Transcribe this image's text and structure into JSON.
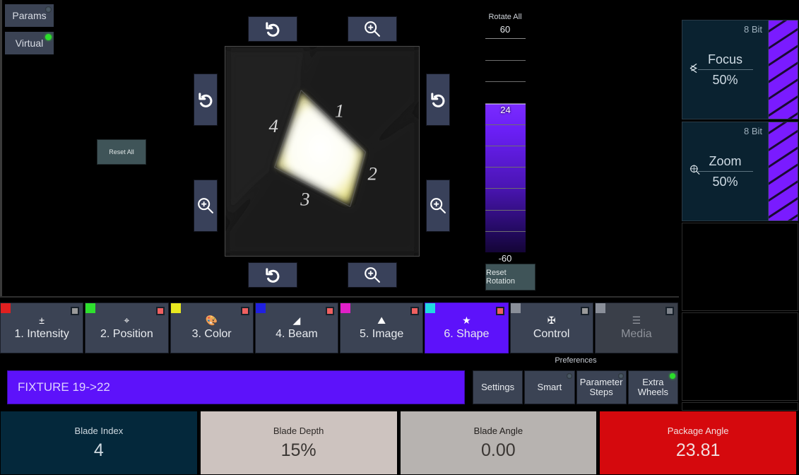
{
  "mode_buttons": [
    {
      "label": "Params",
      "led": "off",
      "name": "params-button"
    },
    {
      "label": "Virtual",
      "led": "on",
      "name": "virtual-button"
    }
  ],
  "preview": {
    "reset_all_label": "Reset All",
    "blade_labels": [
      "1",
      "2",
      "3",
      "4"
    ],
    "nudge_buttons": [
      {
        "name": "rotate-top-button",
        "icon": "rotate-ccw-icon"
      },
      {
        "name": "zoom-top-button",
        "icon": "zoom-in-icon"
      },
      {
        "name": "rotate-left-button",
        "icon": "rotate-ccw-icon"
      },
      {
        "name": "zoom-left-button",
        "icon": "zoom-in-icon"
      },
      {
        "name": "rotate-right-button",
        "icon": "rotate-ccw-icon"
      },
      {
        "name": "zoom-right-button",
        "icon": "zoom-in-icon"
      },
      {
        "name": "rotate-bottom-button",
        "icon": "rotate-ccw-icon"
      },
      {
        "name": "zoom-bottom-button",
        "icon": "zoom-in-icon"
      }
    ]
  },
  "rotate_all": {
    "title": "Rotate All",
    "max": "60",
    "min": "-60",
    "value": "24",
    "value_number": 24,
    "range": [
      -60,
      60
    ],
    "reset_label": "Reset Rotation",
    "fill_color": "#6a1ff5"
  },
  "tabs": [
    {
      "label": "1. Intensity",
      "icon": "plus-minus-icon",
      "glyph": "±",
      "corner": "#e02020",
      "indicator": "#9a9a9a",
      "state": "normal"
    },
    {
      "label": "2. Position",
      "icon": "crosshair-icon",
      "glyph": "⌖",
      "corner": "#2ee02e",
      "indicator": "#f06060",
      "state": "normal"
    },
    {
      "label": "3. Color",
      "icon": "palette-icon",
      "glyph": "🎨",
      "corner": "#e8e820",
      "indicator": "#f06060",
      "state": "normal"
    },
    {
      "label": "4. Beam",
      "icon": "beam-cone-icon",
      "glyph": "◢",
      "corner": "#2020e0",
      "indicator": "#f06060",
      "state": "normal"
    },
    {
      "label": "5. Image",
      "icon": "image-icon",
      "glyph": "⛰",
      "corner": "#e020c8",
      "indicator": "#f06060",
      "state": "normal"
    },
    {
      "label": "6. Shape",
      "icon": "star-icon",
      "glyph": "★",
      "corner": "#20d8e0",
      "indicator": "#f06060",
      "state": "active"
    },
    {
      "label": "Control",
      "icon": "satellite-icon",
      "glyph": "✠",
      "corner": "#8a8f99",
      "indicator": "#9a9a9a",
      "state": "normal"
    },
    {
      "label": "Media",
      "icon": "film-icon",
      "glyph": "☰",
      "corner": "#8a8f99",
      "indicator": "#7d828a",
      "state": "dim"
    }
  ],
  "fixture": {
    "label": "FIXTURE 19->22"
  },
  "preferences": {
    "title": "Preferences",
    "buttons": [
      {
        "label": "Settings",
        "led": "none"
      },
      {
        "label": "Smart",
        "led": "off"
      },
      {
        "label": "Parameter Steps",
        "line1": "Parameter",
        "line2": "Steps",
        "led": "off"
      },
      {
        "label": "Extra Wheels",
        "line1": "Extra",
        "line2": "Wheels",
        "led": "on"
      }
    ]
  },
  "encoders": [
    {
      "title": "Blade Index",
      "value": "4",
      "style": "dark",
      "color": "#04283b"
    },
    {
      "title": "Blade Depth",
      "value": "15%",
      "style": "beige",
      "color": "#cdc3bf"
    },
    {
      "title": "Blade Angle",
      "value": "0.00",
      "style": "gray",
      "color": "#b7b3b0"
    },
    {
      "title": "Package Angle",
      "value": "23.81",
      "style": "red",
      "color": "#d5090d"
    }
  ],
  "right_channels": [
    {
      "name": "Focus",
      "bit": "8 Bit",
      "value": "50%",
      "icon": "focus-icon",
      "bar_color": "#7a1bff"
    },
    {
      "name": "Zoom",
      "bit": "8 Bit",
      "value": "50%",
      "icon": "zoom-magnifier-icon",
      "bar_color": "#7a1bff"
    }
  ]
}
